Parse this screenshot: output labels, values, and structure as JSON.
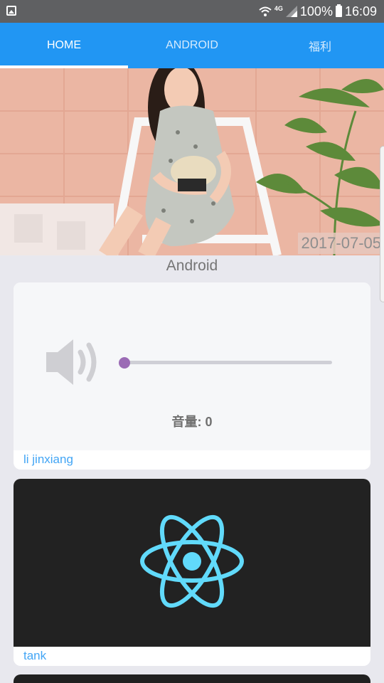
{
  "status_bar": {
    "battery_text": "100%",
    "time": "16:09",
    "network": "4G"
  },
  "tabs": [
    {
      "label": "HOME",
      "active": true
    },
    {
      "label": "ANDROID",
      "active": false
    },
    {
      "label": "福利",
      "active": false
    }
  ],
  "banner": {
    "date": "2017-07-05"
  },
  "section": {
    "title": "Android"
  },
  "cards": [
    {
      "author": "li jinxiang",
      "volume_label": "音量: 0",
      "volume_value": 0
    },
    {
      "author": "tank"
    }
  ],
  "colors": {
    "tab_bar": "#2196f3",
    "status_bar": "#5f6062",
    "author_link": "#42a5f5",
    "slider_thumb": "#9b6bb5",
    "react_blue": "#61dafb"
  }
}
